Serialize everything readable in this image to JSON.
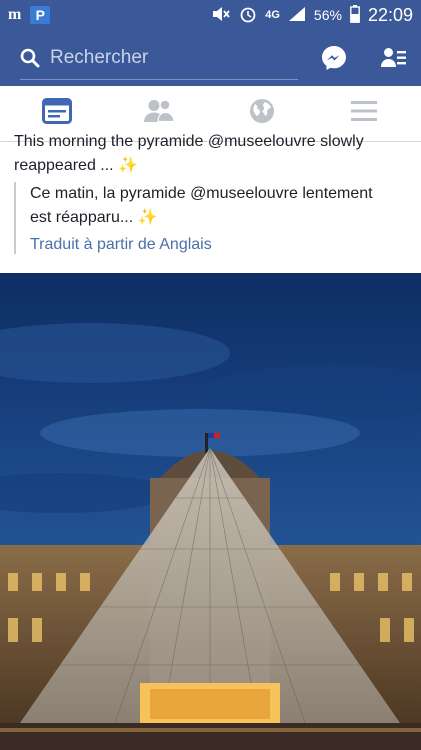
{
  "status_bar": {
    "app_icon_1": "m-icon",
    "app_icon_2_letter": "P",
    "network": "4G",
    "battery": "56%",
    "time": "22:09"
  },
  "header": {
    "search_placeholder": "Rechercher",
    "icons": [
      "search-icon",
      "messenger-icon",
      "friend-requests-icon"
    ]
  },
  "tabs": [
    {
      "name": "news-feed",
      "icon": "news-feed-icon",
      "active": true
    },
    {
      "name": "friends",
      "icon": "friends-icon",
      "active": false
    },
    {
      "name": "notifications",
      "icon": "globe-icon",
      "active": false
    },
    {
      "name": "menu",
      "icon": "menu-icon",
      "active": false
    }
  ],
  "post": {
    "original_line1": "This morning the pyramide @museelouvre slowly",
    "original_line2": "reappeared ...",
    "translated_line1": "Ce matin, la pyramide @museelouvre lentement",
    "translated_line2": "est réapparu...",
    "sparkle": "✨",
    "translation_link": "Traduit à partir de Anglais"
  },
  "colors": {
    "brand": "#3b5998",
    "link": "#4b6fa9",
    "active_tab": "#4267b2",
    "inactive_tab": "#bdc1c9"
  }
}
